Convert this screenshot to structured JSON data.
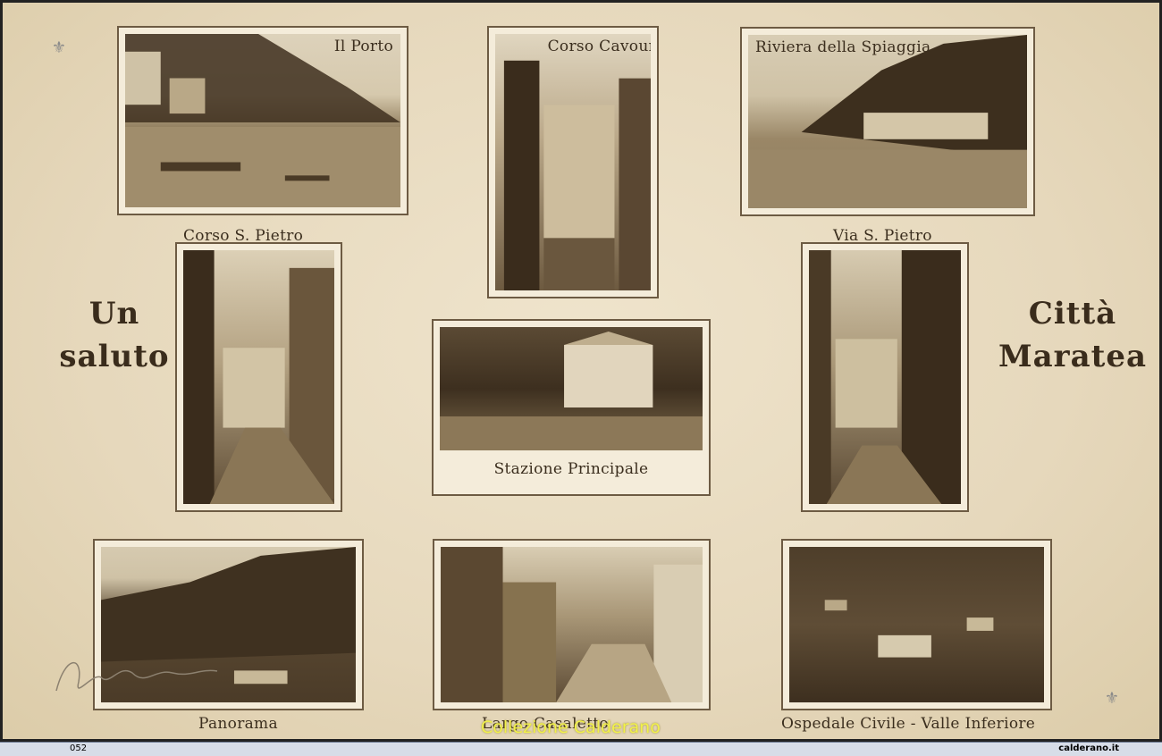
{
  "greeting": {
    "left_line1": "Un",
    "left_line2": "saluto",
    "right_line1": "Città",
    "right_line2": "Maratea"
  },
  "photos": [
    {
      "caption": "Il Porto"
    },
    {
      "caption": "Corso Cavour"
    },
    {
      "caption": "Riviera della Spiaggia"
    },
    {
      "caption": "Corso S. Pietro"
    },
    {
      "caption": "Stazione Principale"
    },
    {
      "caption": "Via S. Pietro"
    },
    {
      "caption": "Panorama"
    },
    {
      "caption": "Largo Casaletto"
    },
    {
      "caption": "Ospedale Civile - Valle Inferiore"
    }
  ],
  "watermark": "Collezione Calderano",
  "footer": {
    "id": "052",
    "site": "calderano.it"
  },
  "icons": {
    "top_left": "crest-icon",
    "bottom_right": "crest-icon"
  }
}
